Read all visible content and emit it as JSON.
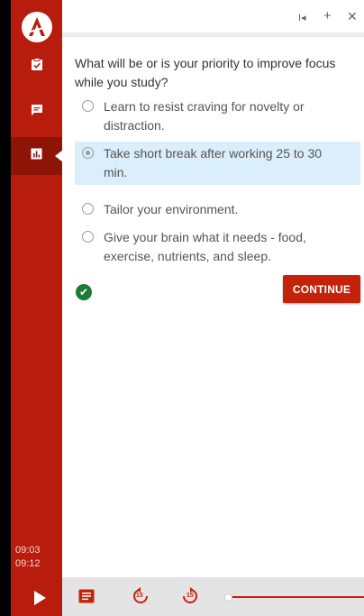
{
  "times": {
    "current": "09:03",
    "total": "09:12"
  },
  "topbar": {
    "prev": "I◂",
    "expand": "+",
    "close": "✕"
  },
  "question": "What will be or is your priority to improve focus while you study?",
  "options": [
    {
      "text": "Learn to resist craving for novelty or distraction.",
      "selected": false
    },
    {
      "text": "Take short break after working 25 to 30 min.",
      "selected": true
    },
    {
      "text": "Tailor your environment.",
      "selected": false
    },
    {
      "text": "Give your brain what it needs - food, exercise, nutrients, and sleep.",
      "selected": false
    }
  ],
  "continue_label": "CONTINUE",
  "bottombar": {
    "rewind_label": "15",
    "forward_label": "15"
  },
  "colors": {
    "brand": "#b71c0c",
    "button": "#c5220c",
    "selected_bg": "#dbeefb",
    "check": "#1e7a36"
  },
  "icons": [
    "logo-icon",
    "checklist-icon",
    "chat-icon",
    "chart-icon",
    "play-icon",
    "transcript-icon",
    "rewind-15-icon",
    "forward-15-icon"
  ]
}
